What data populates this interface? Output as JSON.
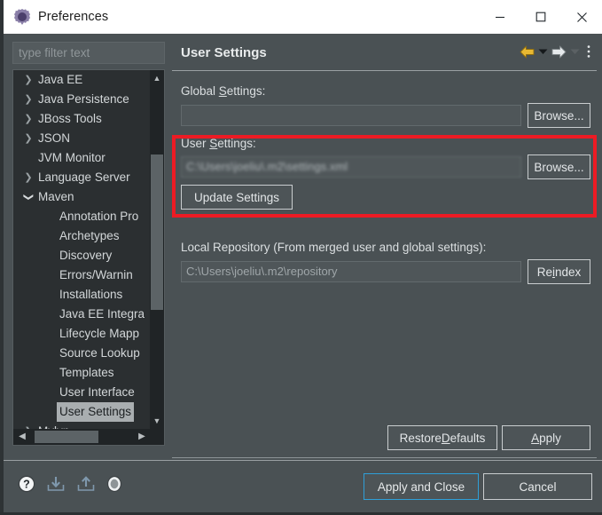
{
  "window": {
    "title": "Preferences",
    "icon": "cog-icon",
    "controls": {
      "minimize": "minimize-icon",
      "maximize": "maximize-icon",
      "close": "close-icon"
    }
  },
  "sidebar": {
    "filter": {
      "value": "",
      "placeholder": "type filter text"
    },
    "items": [
      {
        "label": "Java EE",
        "level": 1,
        "twisty": "collapsed",
        "selected": false
      },
      {
        "label": "Java Persistence",
        "level": 1,
        "twisty": "collapsed",
        "selected": false
      },
      {
        "label": "JBoss Tools",
        "level": 1,
        "twisty": "collapsed",
        "selected": false
      },
      {
        "label": "JSON",
        "level": 1,
        "twisty": "collapsed",
        "selected": false
      },
      {
        "label": "JVM Monitor",
        "level": 1,
        "twisty": "none",
        "selected": false
      },
      {
        "label": "Language Server",
        "level": 1,
        "twisty": "collapsed",
        "selected": false
      },
      {
        "label": "Maven",
        "level": 1,
        "twisty": "expanded",
        "selected": false
      },
      {
        "label": "Annotation Pro",
        "level": 2,
        "twisty": "none",
        "selected": false
      },
      {
        "label": "Archetypes",
        "level": 2,
        "twisty": "none",
        "selected": false
      },
      {
        "label": "Discovery",
        "level": 2,
        "twisty": "none",
        "selected": false
      },
      {
        "label": "Errors/Warnin",
        "level": 2,
        "twisty": "none",
        "selected": false
      },
      {
        "label": "Installations",
        "level": 2,
        "twisty": "none",
        "selected": false
      },
      {
        "label": "Java EE Integra",
        "level": 2,
        "twisty": "none",
        "selected": false
      },
      {
        "label": "Lifecycle Mapp",
        "level": 2,
        "twisty": "none",
        "selected": false
      },
      {
        "label": "Source Lookup",
        "level": 2,
        "twisty": "none",
        "selected": false
      },
      {
        "label": "Templates",
        "level": 2,
        "twisty": "none",
        "selected": false
      },
      {
        "label": "User Interface",
        "level": 2,
        "twisty": "none",
        "selected": false
      },
      {
        "label": "User Settings",
        "level": 2,
        "twisty": "none",
        "selected": true
      },
      {
        "label": "Mylyn",
        "level": 1,
        "twisty": "collapsed",
        "selected": false
      }
    ],
    "scroll": {
      "vertical": "scrollbar-vertical",
      "horizontal": "scrollbar-horizontal"
    }
  },
  "panel": {
    "title": "User Settings",
    "toolbar": [
      {
        "name": "back-arrow-icon",
        "enabled": true
      },
      {
        "name": "back-dropdown-icon",
        "enabled": true
      },
      {
        "name": "forward-arrow-icon",
        "enabled": true
      },
      {
        "name": "forward-dropdown-icon",
        "enabled": false
      },
      {
        "name": "overflow-menu-icon",
        "enabled": true
      }
    ],
    "global_settings": {
      "label_pre": "Global ",
      "label_mnemonic": "S",
      "label_post": "ettings:",
      "value": "",
      "browse_label": "Browse..."
    },
    "user_settings": {
      "label_pre": "User ",
      "label_mnemonic": "S",
      "label_post": "ettings:",
      "value": "C:\\Users\\joeliu\\.m2\\settings.xml",
      "value_redacted": true,
      "browse_label": "Browse...",
      "update_label": "Update Settings",
      "highlight_color": "#ed1b24"
    },
    "local_repository": {
      "label": "Local Repository (From merged user and global settings):",
      "value": "C:\\Users\\joeliu\\.m2\\repository",
      "reindex_pre": "Re",
      "reindex_mnemonic": "i",
      "reindex_post": "ndex"
    },
    "restore_defaults": {
      "pre": "Restore ",
      "mnemonic": "D",
      "post": "efaults"
    },
    "apply": {
      "pre": "",
      "mnemonic": "A",
      "post": "pply"
    }
  },
  "footer": {
    "icons": [
      {
        "name": "help-icon"
      },
      {
        "name": "import-icon"
      },
      {
        "name": "export-icon"
      },
      {
        "name": "oval-status-icon"
      }
    ],
    "apply_and_close_label": "Apply and Close",
    "cancel_label": "Cancel",
    "focus_color": "#2f9fd8"
  }
}
